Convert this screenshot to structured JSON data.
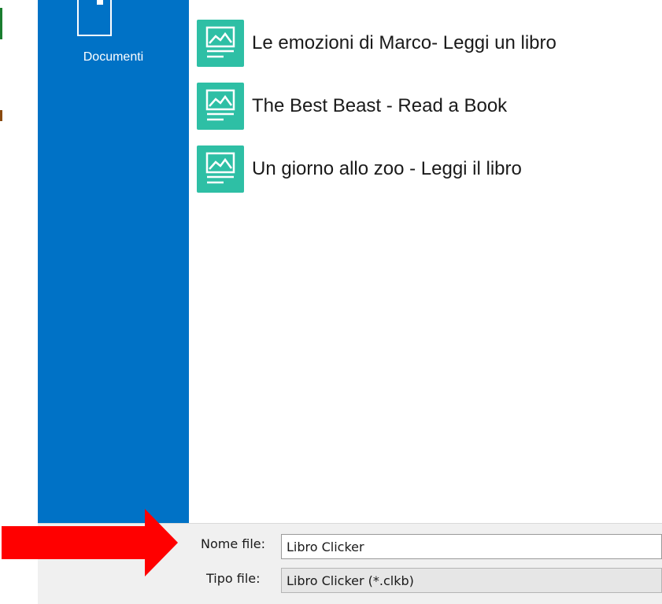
{
  "sidebar": {
    "items": [
      {
        "label": "Documenti",
        "icon": "folder-icon"
      }
    ],
    "color": "#0072c6"
  },
  "files": [
    {
      "name": "Le emozioni di Marco- Leggi un libro",
      "icon": "image-document-icon"
    },
    {
      "name": "The Best Beast - Read a Book",
      "icon": "image-document-icon"
    },
    {
      "name": "Un giorno allo zoo - Leggi il libro",
      "icon": "image-document-icon"
    }
  ],
  "file_icon_color": "#2ebfa5",
  "save_form": {
    "filename_label": "Nome file:",
    "filename_value": "Libro Clicker",
    "filetype_label": "Tipo file:",
    "filetype_value": "Libro Clicker (*.clkb)"
  },
  "annotation": {
    "icon": "red-arrow-icon",
    "color": "#ff0000"
  }
}
